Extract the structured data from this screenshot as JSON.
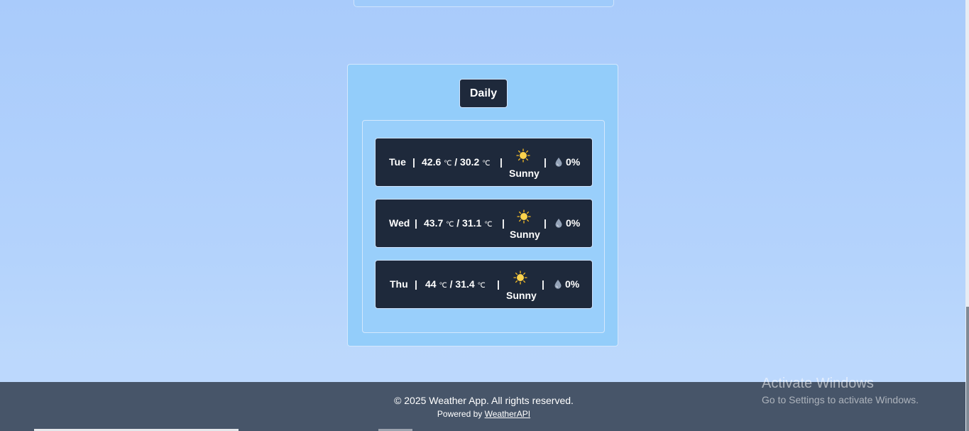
{
  "daily": {
    "title": "Daily",
    "days": [
      {
        "day": "Tue",
        "max": "42.6",
        "min": "30.2",
        "unit": "℃",
        "condition": "Sunny",
        "rain": "0%"
      },
      {
        "day": "Wed",
        "max": "43.7",
        "min": "31.1",
        "unit": "℃",
        "condition": "Sunny",
        "rain": "0%"
      },
      {
        "day": "Thu",
        "max": "44",
        "min": "31.4",
        "unit": "℃",
        "condition": "Sunny",
        "rain": "0%"
      }
    ],
    "separator": "|",
    "slash": "/"
  },
  "footer": {
    "copyright": "© 2025 Weather App. All rights reserved.",
    "powered_prefix": "Powered by",
    "powered_link": "WeatherAPI"
  },
  "overlay": {
    "activate_title": "Activate Windows",
    "activate_sub": "Go to Settings to activate Windows."
  },
  "colors": {
    "card_bg": "#1e293b",
    "panel_bg": "#93cdfa",
    "footer_bg": "#475569",
    "sun": "#fcd34d"
  },
  "icons": {
    "condition": "sun-icon",
    "rain": "raindrop-icon"
  }
}
